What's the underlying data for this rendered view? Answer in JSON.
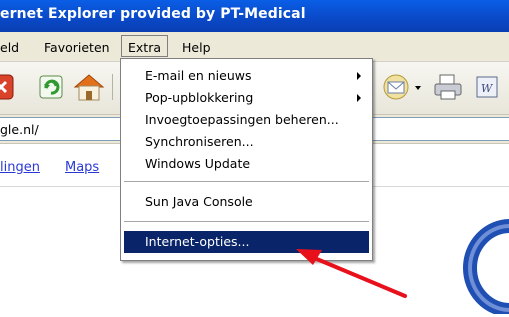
{
  "window": {
    "title": "ernet Explorer provided by PT-Medical"
  },
  "menubar": {
    "items": [
      {
        "label": "eld"
      },
      {
        "label": "Favorieten"
      },
      {
        "label": "Extra"
      },
      {
        "label": "Help"
      }
    ]
  },
  "address": {
    "value": "gle.nl/"
  },
  "content": {
    "links": [
      {
        "label": "lingen"
      },
      {
        "label": "Maps"
      }
    ]
  },
  "extra_menu": {
    "items": [
      {
        "label": "E-mail en nieuws",
        "submenu": true
      },
      {
        "label": "Pop-upblokkering",
        "submenu": true
      },
      {
        "label": "Invoegtoepassingen beheren..."
      },
      {
        "label": "Synchroniseren..."
      },
      {
        "label": "Windows Update"
      },
      {
        "label": "Sun Java Console"
      },
      {
        "label": "Internet-opties..."
      }
    ],
    "selected_index": 6
  },
  "colors": {
    "titlebar": "#0a48c6",
    "menu_highlight": "#0a246a",
    "link": "#2a39d6",
    "annotation_arrow": "#e8101a"
  },
  "icons": [
    "stop-icon",
    "refresh-icon",
    "home-icon",
    "mail-icon",
    "print-icon",
    "word-icon",
    "google-logo-fragment"
  ]
}
